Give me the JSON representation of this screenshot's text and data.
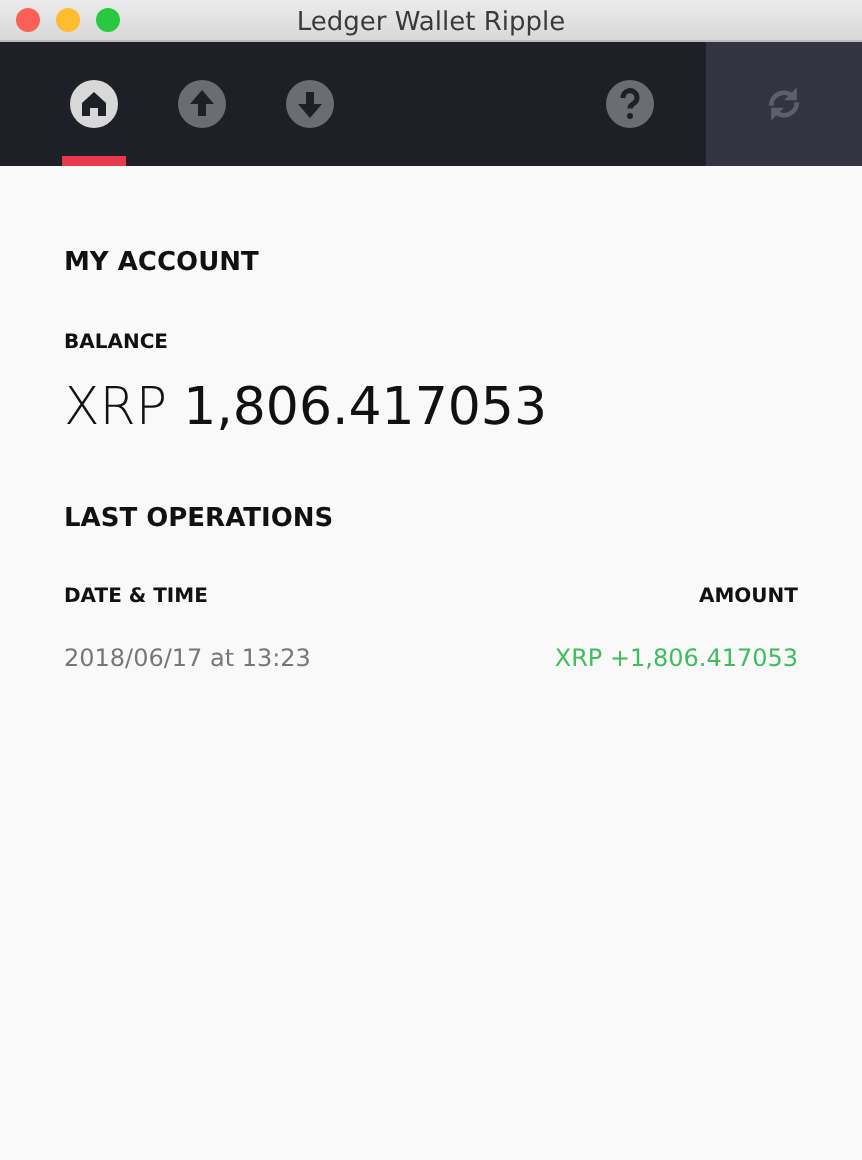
{
  "window": {
    "title": "Ledger Wallet Ripple"
  },
  "nav": [
    {
      "kind": "home",
      "selected": true
    },
    {
      "kind": "send",
      "selected": false
    },
    {
      "kind": "receive",
      "selected": false
    }
  ],
  "account": {
    "title": "MY ACCOUNT",
    "balance_label": "BALANCE",
    "currency": "XRP",
    "amount": "1,806.417053"
  },
  "operations": {
    "title": "LAST OPERATIONS",
    "columns": [
      "DATE & TIME",
      "AMOUNT"
    ],
    "rows": [
      {
        "date": "2018/06/17 at 13:23",
        "amount": "XRP +1,806.417053"
      }
    ]
  }
}
